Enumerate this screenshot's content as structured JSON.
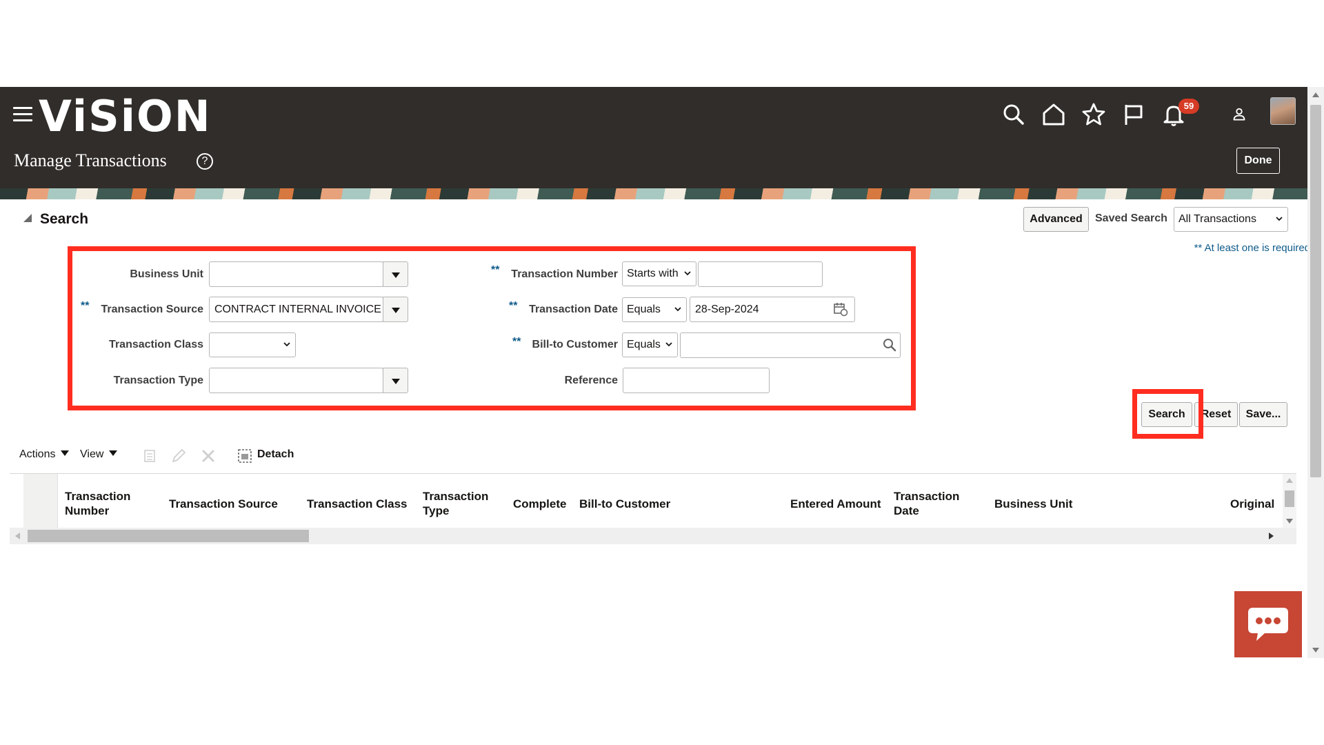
{
  "header": {
    "logo": "ViSiON",
    "page_title": "Manage Transactions",
    "notification_count": "59",
    "done_label": "Done",
    "icons": [
      "menu-icon",
      "search-icon",
      "home-icon",
      "star-icon",
      "flag-icon",
      "bell-icon",
      "user-icon"
    ]
  },
  "search": {
    "heading": "Search",
    "advanced_label": "Advanced",
    "saved_search_label": "Saved Search",
    "saved_search_value": "All Transactions",
    "required_note": "** At least one is required",
    "required_marker": "**",
    "fields": {
      "business_unit": {
        "label": "Business Unit",
        "value": ""
      },
      "transaction_source": {
        "label": "Transaction Source",
        "value": "CONTRACT INTERNAL INVOICE"
      },
      "transaction_class": {
        "label": "Transaction Class",
        "value": ""
      },
      "transaction_type": {
        "label": "Transaction Type",
        "value": ""
      },
      "transaction_number": {
        "label": "Transaction Number",
        "operator": "Starts with",
        "value": ""
      },
      "transaction_date": {
        "label": "Transaction Date",
        "operator": "Equals",
        "value": "28-Sep-2024"
      },
      "bill_to_customer": {
        "label": "Bill-to Customer",
        "operator": "Equals",
        "value": ""
      },
      "reference": {
        "label": "Reference",
        "value": ""
      }
    },
    "buttons": {
      "search": "Search",
      "reset": "Reset",
      "save": "Save..."
    }
  },
  "toolbar": {
    "actions": "Actions",
    "view": "View",
    "detach": "Detach"
  },
  "table": {
    "columns": [
      [
        "Transaction",
        "Number"
      ],
      [
        "Transaction Source"
      ],
      [
        "Transaction Class"
      ],
      [
        "Transaction",
        "Type"
      ],
      [
        "Complete"
      ],
      [
        "Bill-to Customer"
      ],
      [
        "Entered Amount"
      ],
      [
        "Transaction",
        "Date"
      ],
      [
        "Business Unit"
      ],
      [
        "Original"
      ]
    ]
  },
  "colors": {
    "header_bg": "#312d2a",
    "highlight": "#ff2d20",
    "required": "#0e5a8a",
    "chat": "#c74634"
  }
}
